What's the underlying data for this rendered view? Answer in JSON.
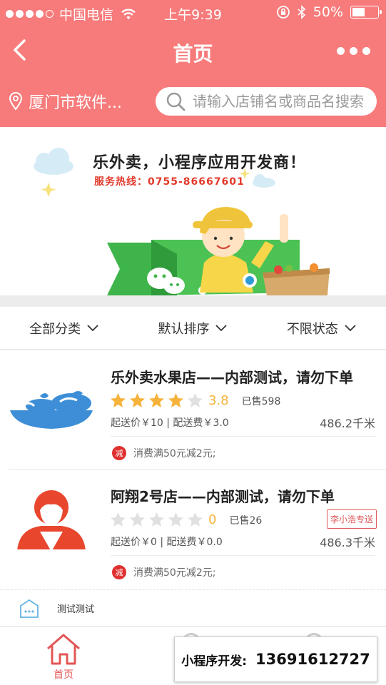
{
  "status_bar": {
    "carrier": "中国电信",
    "time": "上午9:39",
    "battery_percent": "50%",
    "battery_level": 0.5
  },
  "nav": {
    "title": "首页"
  },
  "location": {
    "label": "厦门市软件..."
  },
  "search": {
    "placeholder": "请输入店铺名或商品名搜索"
  },
  "banner": {
    "headline": "乐外卖，小程序应用开发商！",
    "hotline": "服务热线：0755-86667601"
  },
  "filters": [
    {
      "label": "全部分类"
    },
    {
      "label": "默认排序"
    },
    {
      "label": "不限状态"
    }
  ],
  "shops": [
    {
      "name": "乐外卖水果店——内部测试，请勿下单",
      "rating": 3.8,
      "score_text": "3.8",
      "sold": "已售598",
      "fees": "起送价￥10 | 配送费￥3.0",
      "distance": "486.2千米",
      "promo_tag": "减",
      "promo": "消费满50元减2元;",
      "delivery_badge": ""
    },
    {
      "name": "阿翔2号店——内部测试，请勿下单",
      "rating": 0,
      "score_text": "0",
      "sold": "已售26",
      "fees": "起送价￥0 | 配送费￥0.0",
      "distance": "486.3千米",
      "promo_tag": "减",
      "promo": "消费满50元减2元;",
      "delivery_badge": "李小浩专送"
    }
  ],
  "notice": {
    "text": "测试测试"
  },
  "tabbar": {
    "home_label": "首页"
  },
  "promo_box": {
    "label": "小程序开发:",
    "phone": "13691612727"
  },
  "colors": {
    "brand": "#f77b7b",
    "star": "#f6b33b",
    "star_empty": "#e0e0e0",
    "accent_red": "#e35656"
  }
}
